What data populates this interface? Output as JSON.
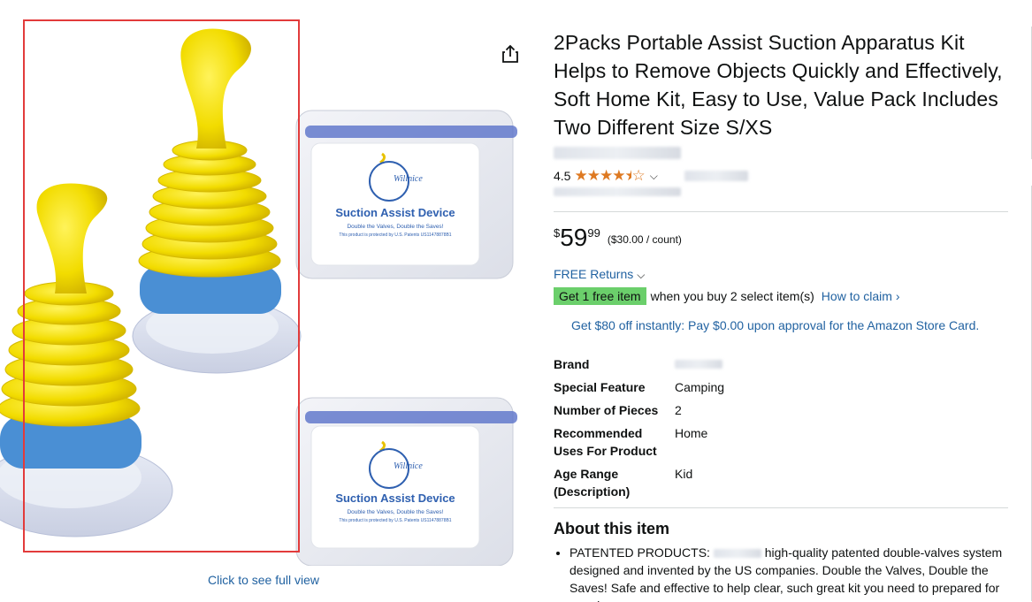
{
  "image": {
    "full_view_link": "Click to see full view",
    "box_label_line1": "Suction Assist Device",
    "box_label_line2": "Double the Valves, Double the Saves!",
    "box_label_line3": "This product is protected by U.S. Patents US11478878B1",
    "brand_arc": "Willnice"
  },
  "product": {
    "title": "2Packs Portable Assist Suction Apparatus Kit Helps to Remove Objects Quickly and Effectively, Soft Home Kit, Easy to Use, Value Pack Includes Two Different Size S/XS",
    "rating": "4.5",
    "stars_icon": "star-rating-4.5",
    "price_symbol": "$",
    "price_whole": "59",
    "price_fraction": "99",
    "price_per_unit": "($30.00 / count)",
    "returns": "FREE Returns",
    "promo_badge": "Get 1 free item",
    "promo_text": "when you buy 2 select item(s)",
    "promo_link": "How to claim ›",
    "card_offer": "Get $80 off instantly: Pay $0.00 upon approval for the Amazon Store Card."
  },
  "specs": [
    {
      "key": "Brand",
      "value": ""
    },
    {
      "key": "Special Feature",
      "value": "Camping"
    },
    {
      "key": "Number of Pieces",
      "value": "2"
    },
    {
      "key": "Recommended Uses For Product",
      "value": "Home"
    },
    {
      "key": "Age Range (Description)",
      "value": "Kid"
    }
  ],
  "about": {
    "heading": "About this item",
    "bullet1_prefix": "PATENTED PRODUCTS:",
    "bullet1_rest": "high-quality patented double-valves system designed and invented by the US companies. Double the Valves, Double the Saves! Safe and effective to help clear, such great kit you need to prepared for your home."
  },
  "colors": {
    "link": "#2162a1",
    "star": "#de7921",
    "badge": "#6bcf6b",
    "selection": "#e23b3b",
    "device_yellow": "#f5e000",
    "device_blue": "#4a8fd4"
  }
}
